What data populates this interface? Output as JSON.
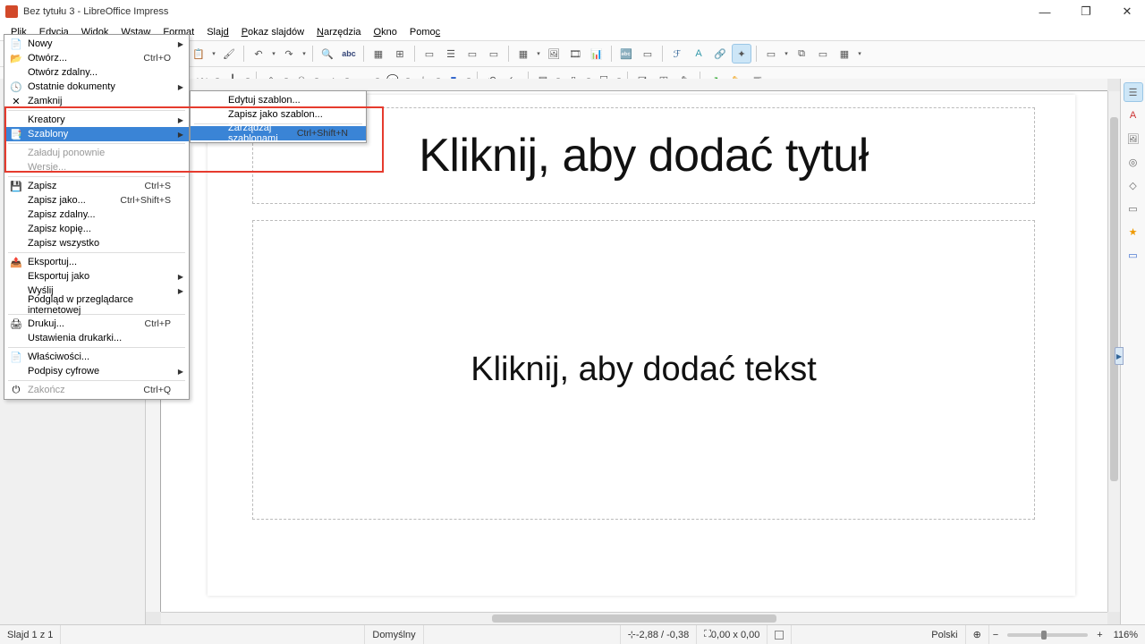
{
  "window": {
    "title": "Bez tytułu 3 - LibreOffice Impress"
  },
  "menubar": [
    "Plik",
    "Edycja",
    "Widok",
    "Wstaw",
    "Format",
    "Slajd",
    "Pokaz slajdów",
    "Narzędzia",
    "Okno",
    "Pomoc"
  ],
  "menubar_underline": [
    "P",
    "E",
    "W",
    "W",
    "F",
    "S",
    "P",
    "N",
    "O",
    "P"
  ],
  "file_menu": {
    "items": [
      {
        "label": "Nowy",
        "arrow": true,
        "icon": "doc"
      },
      {
        "label": "Otwórz...",
        "shortcut": "Ctrl+O",
        "icon": "folder"
      },
      {
        "label": "Otwórz zdalny..."
      },
      {
        "label": "Ostatnie dokumenty",
        "arrow": true,
        "icon": "recent"
      },
      {
        "label": "Zamknij",
        "icon": "close"
      },
      {
        "sep": true
      },
      {
        "label": "Kreatory",
        "arrow": true
      },
      {
        "label": "Szablony",
        "arrow": true,
        "highlighted": true,
        "icon": "template"
      },
      {
        "sep": true
      },
      {
        "label": "Załaduj ponownie",
        "disabled": true
      },
      {
        "label": "Wersje...",
        "disabled": true
      },
      {
        "sep": true
      },
      {
        "label": "Zapisz",
        "shortcut": "Ctrl+S",
        "icon": "save"
      },
      {
        "label": "Zapisz jako...",
        "shortcut": "Ctrl+Shift+S"
      },
      {
        "label": "Zapisz zdalny..."
      },
      {
        "label": "Zapisz kopię..."
      },
      {
        "label": "Zapisz wszystko"
      },
      {
        "sep": true
      },
      {
        "label": "Eksportuj...",
        "icon": "export"
      },
      {
        "label": "Eksportuj jako",
        "arrow": true
      },
      {
        "label": "Wyślij",
        "arrow": true
      },
      {
        "label": "Podgląd w przeglądarce internetowej"
      },
      {
        "sep": true
      },
      {
        "label": "Drukuj...",
        "shortcut": "Ctrl+P",
        "icon": "print"
      },
      {
        "label": "Ustawienia drukarki..."
      },
      {
        "sep": true
      },
      {
        "label": "Właściwości...",
        "icon": "props"
      },
      {
        "label": "Podpisy cyfrowe",
        "arrow": true
      },
      {
        "sep": true
      },
      {
        "label": "Zakończ",
        "shortcut": "Ctrl+Q",
        "icon": "exit",
        "disabled": true
      }
    ]
  },
  "templates_submenu": {
    "items": [
      {
        "label": "Edytuj szablon..."
      },
      {
        "label": "Zapisz jako szablon..."
      },
      {
        "sep": true
      },
      {
        "label": "Zarządzaj szablonami",
        "shortcut": "Ctrl+Shift+N",
        "highlighted": true
      }
    ]
  },
  "slide": {
    "title_placeholder": "Kliknij, aby dodać tytuł",
    "content_placeholder": "Kliknij, aby dodać tekst"
  },
  "statusbar": {
    "slide_count": "Slajd 1 z 1",
    "master": "Domyślny",
    "coords": "-2,88 / -0,38",
    "size": "0,00 x 0,00",
    "lang": "Polski",
    "zoom": "116%"
  },
  "icons": {
    "curve": "curve",
    "line": "line",
    "rect": "rect",
    "ellipse": "ellipse",
    "smiley": "smiley",
    "arrow": "arrow",
    "star": "star",
    "fill": "fill"
  }
}
